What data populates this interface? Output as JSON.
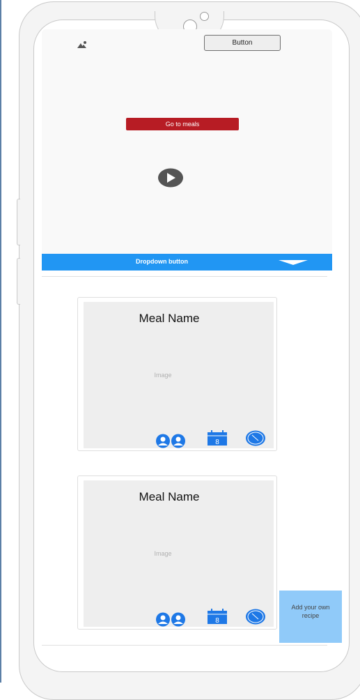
{
  "header": {
    "image_icon": "image-icon",
    "top_button_label": "Button"
  },
  "hero": {
    "go_to_meals_label": "Go to meals",
    "play_icon": "play-icon"
  },
  "dropdown": {
    "label": "Dropdown button",
    "arrow_icon": "dropdown-arrow-icon"
  },
  "meals": [
    {
      "name": "Meal Name",
      "image_label": "Image",
      "servings_icon": "people-icon",
      "calendar_icon": "calendar-icon",
      "calendar_day": "8",
      "time_icon": "clock-icon"
    },
    {
      "name": "Meal Name",
      "image_label": "Image",
      "servings_icon": "people-icon",
      "calendar_icon": "calendar-icon",
      "calendar_day": "8",
      "time_icon": "clock-icon"
    }
  ],
  "add_recipe": {
    "label": "Add your own recipe"
  },
  "colors": {
    "accent_blue": "#2196f3",
    "icon_blue": "#1e78e6",
    "cta_red": "#b71c24",
    "add_recipe_bg": "#90caf9"
  }
}
